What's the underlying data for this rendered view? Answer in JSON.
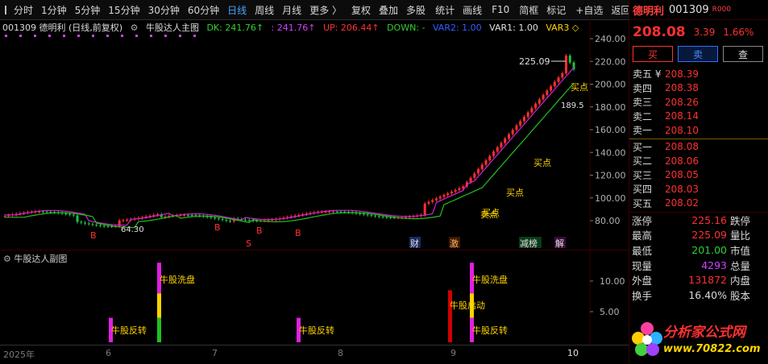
{
  "toolbar": {
    "items": [
      {
        "label": "分时",
        "active": false
      },
      {
        "label": "1分钟",
        "active": false
      },
      {
        "label": "5分钟",
        "active": false
      },
      {
        "label": "15分钟",
        "active": false
      },
      {
        "label": "30分钟",
        "active": false
      },
      {
        "label": "60分钟",
        "active": false
      },
      {
        "label": "日线",
        "active": true
      },
      {
        "label": "周线",
        "active": false
      },
      {
        "label": "月线",
        "active": false
      },
      {
        "label": "更多 〉",
        "active": false
      },
      {
        "label": "复权",
        "active": false
      },
      {
        "label": "叠加",
        "active": false
      },
      {
        "label": "多股",
        "active": false
      },
      {
        "label": "统计",
        "active": false
      },
      {
        "label": "画线",
        "active": false
      },
      {
        "label": "F10",
        "active": false
      },
      {
        "label": "简框",
        "active": false
      },
      {
        "label": "标记",
        "active": false
      },
      {
        "label": "+自选",
        "active": false
      },
      {
        "label": "返回",
        "active": false
      }
    ]
  },
  "main": {
    "title": "001309 德明利 (日线,前复权)",
    "indicator": "牛股达人主图",
    "dk_label": "DK: 241.76↑",
    "dk2_label": ": 241.76↑",
    "up_label": "UP: 206.44↑",
    "down_label": "DOWN: -",
    "var2_label": "VAR2: 1.00",
    "var1_label": "VAR1: 1.00",
    "var3_label": "VAR3 ◇",
    "high_mark": "225.09",
    "low_mark": "64.30",
    "pt_mark": "189.5",
    "buy_label": "买点",
    "sell_label": "卖点",
    "b_label": "B",
    "s_label": "S",
    "tag_cai": "财",
    "tag_ji": "激",
    "tag_jianchi": "减榜",
    "tag_jie": "解",
    "y_ticks": [
      "240.00",
      "220.00",
      "200.00",
      "180.00",
      "160.00",
      "140.00",
      "120.00",
      "100.00",
      "80.00"
    ]
  },
  "sub": {
    "title": "牛股达人副图",
    "y_ticks": [
      "10.00",
      "5.00"
    ],
    "labels": {
      "reverse": "牛股反转",
      "wash": "牛股洗盘",
      "start": "牛股启动"
    }
  },
  "dates": {
    "year": "2025年",
    "m6": "6",
    "m7": "7",
    "m8": "8",
    "m9": "9",
    "m10": "10"
  },
  "quote": {
    "name": "德明利",
    "code": "001309",
    "tag": "R000",
    "price": "208.08",
    "change": "3.39",
    "pct": "1.66%",
    "btn_buy": "买",
    "btn_sell": "卖",
    "btn_query": "查",
    "asks": [
      {
        "label": "卖五 ¥",
        "price": "208.39"
      },
      {
        "label": "卖四",
        "price": "208.38"
      },
      {
        "label": "卖三",
        "price": "208.26"
      },
      {
        "label": "卖二",
        "price": "208.14"
      },
      {
        "label": "卖一",
        "price": "208.10"
      }
    ],
    "bids": [
      {
        "label": "买一",
        "price": "208.08"
      },
      {
        "label": "买二",
        "price": "208.06"
      },
      {
        "label": "买三",
        "price": "208.05"
      },
      {
        "label": "买四",
        "price": "208.03"
      },
      {
        "label": "买五",
        "price": "208.02"
      }
    ],
    "stats": [
      {
        "label": "涨停",
        "value": "225.16",
        "color": "#ff3030",
        "label2": "跌停"
      },
      {
        "label": "最高",
        "value": "225.09",
        "color": "#ff3030",
        "label2": "量比"
      },
      {
        "label": "最低",
        "value": "201.00",
        "color": "#30d030",
        "label2": "市值"
      },
      {
        "label": "现量",
        "value": "4293",
        "color": "#d040ff",
        "label2": "总量"
      },
      {
        "label": "外盘",
        "value": "131872",
        "color": "#ff3030",
        "label2": "内盘"
      },
      {
        "label": "换手",
        "value": "16.40%",
        "color": "#d8d8d8",
        "label2": "股本"
      }
    ],
    "logo_text": "分析家公式网",
    "logo_url": "www.70822.com"
  },
  "colors": {
    "up": "#ff3030",
    "down": "#20c040",
    "dk": "#d020d0",
    "accent": "#4aa3ff"
  }
}
